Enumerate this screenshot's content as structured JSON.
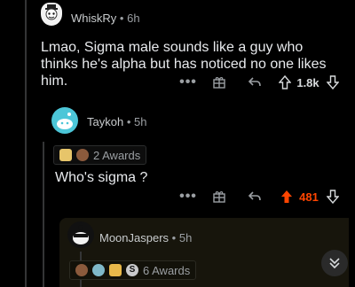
{
  "comments": [
    {
      "username": "WhiskRy",
      "time": "6h",
      "text": "Lmao, Sigma male sounds like a guy who thinks he's alpha but has noticed no one likes him.",
      "votes": "1.8k",
      "upvoted": false
    },
    {
      "username": "Taykoh",
      "time": "5h",
      "awards_label": "2 Awards",
      "text": "Who's sigma ?",
      "votes": "481",
      "upvoted": true
    },
    {
      "username": "MoonJaspers",
      "time": "5h",
      "awards_label": "6 Awards"
    }
  ],
  "separator": "•",
  "more_actions": "•••",
  "icons": [
    "award-gift-icon",
    "reply-arrow-icon",
    "upvote-arrow-icon",
    "downvote-arrow-icon",
    "double-chevron-down-icon"
  ],
  "colors": {
    "background": "#000000",
    "upvote": "#ff4500",
    "highlight": "#17150c"
  }
}
